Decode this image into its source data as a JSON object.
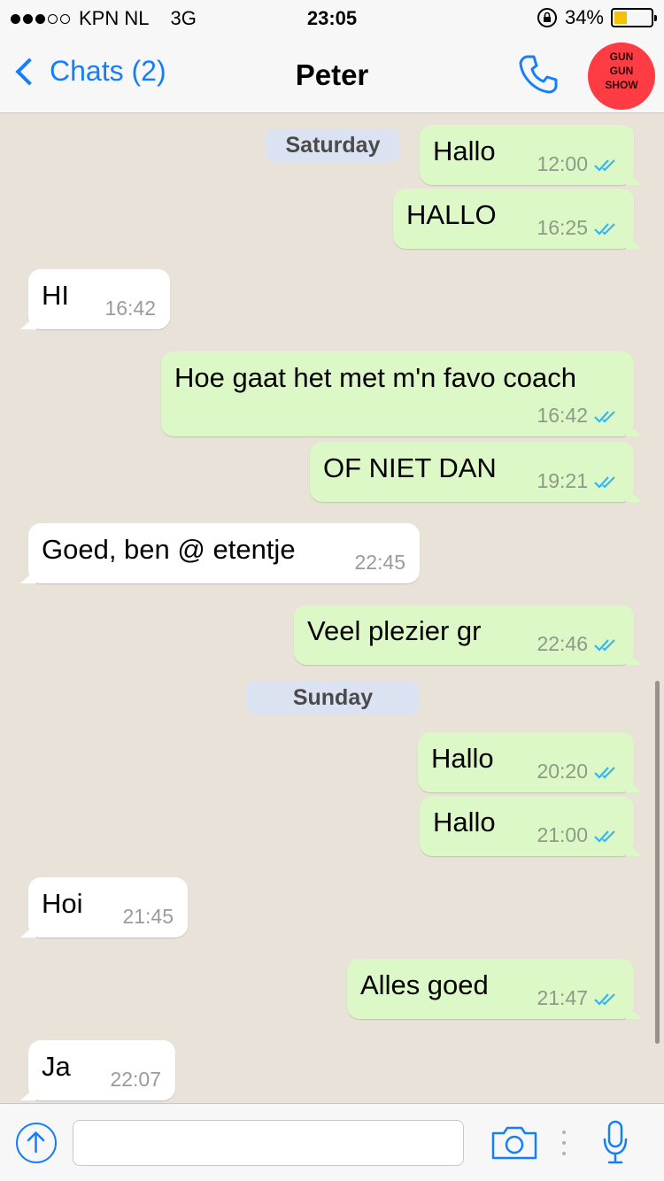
{
  "status_bar": {
    "carrier": "KPN NL",
    "network": "3G",
    "time": "23:05",
    "battery_percent": "34%",
    "battery_level": 0.34,
    "signal_bars_filled": 3,
    "signal_bars_total": 5
  },
  "nav": {
    "back_label": "Chats (2)",
    "title": "Peter",
    "avatar_text": "GUN GUN SHOW"
  },
  "chat": {
    "days": [
      {
        "label": "Saturday"
      },
      {
        "label": "Sunday"
      }
    ],
    "messages": [
      {
        "direction": "out",
        "text": "Hallo",
        "time": "12:00",
        "read": true
      },
      {
        "direction": "out",
        "text": "HALLO",
        "time": "16:25",
        "read": true
      },
      {
        "direction": "in",
        "text": "HI",
        "time": "16:42"
      },
      {
        "direction": "out",
        "text": "Hoe gaat het met m'n favo coach",
        "time": "16:42",
        "read": true
      },
      {
        "direction": "out",
        "text": "OF NIET DAN",
        "time": "19:21",
        "read": true
      },
      {
        "direction": "in",
        "text": "Goed, ben @ etentje",
        "time": "22:45"
      },
      {
        "direction": "out",
        "text": "Veel plezier gr",
        "time": "22:46",
        "read": true
      },
      {
        "direction": "out",
        "text": "Hallo",
        "time": "20:20",
        "read": true
      },
      {
        "direction": "out",
        "text": "Hallo",
        "time": "21:00",
        "read": true
      },
      {
        "direction": "in",
        "text": "Hoi",
        "time": "21:45"
      },
      {
        "direction": "out",
        "text": "Alles goed",
        "time": "21:47",
        "read": true
      },
      {
        "direction": "in",
        "text": "Ja",
        "time": "22:07"
      }
    ]
  },
  "input": {
    "placeholder": ""
  },
  "colors": {
    "accent": "#147efb",
    "outgoing_bubble": "#dcf8c6",
    "incoming_bubble": "#ffffff",
    "read_ticks": "#34b7f1",
    "chat_background": "#e8e2d8",
    "battery": "#f4c200"
  },
  "icons": {
    "back": "chevron-left-icon",
    "call": "phone-icon",
    "share": "arrow-up-circle-icon",
    "camera": "camera-icon",
    "more": "vertical-dots-icon",
    "mic": "microphone-icon",
    "read": "double-check-icon",
    "lock": "rotation-lock-icon"
  }
}
